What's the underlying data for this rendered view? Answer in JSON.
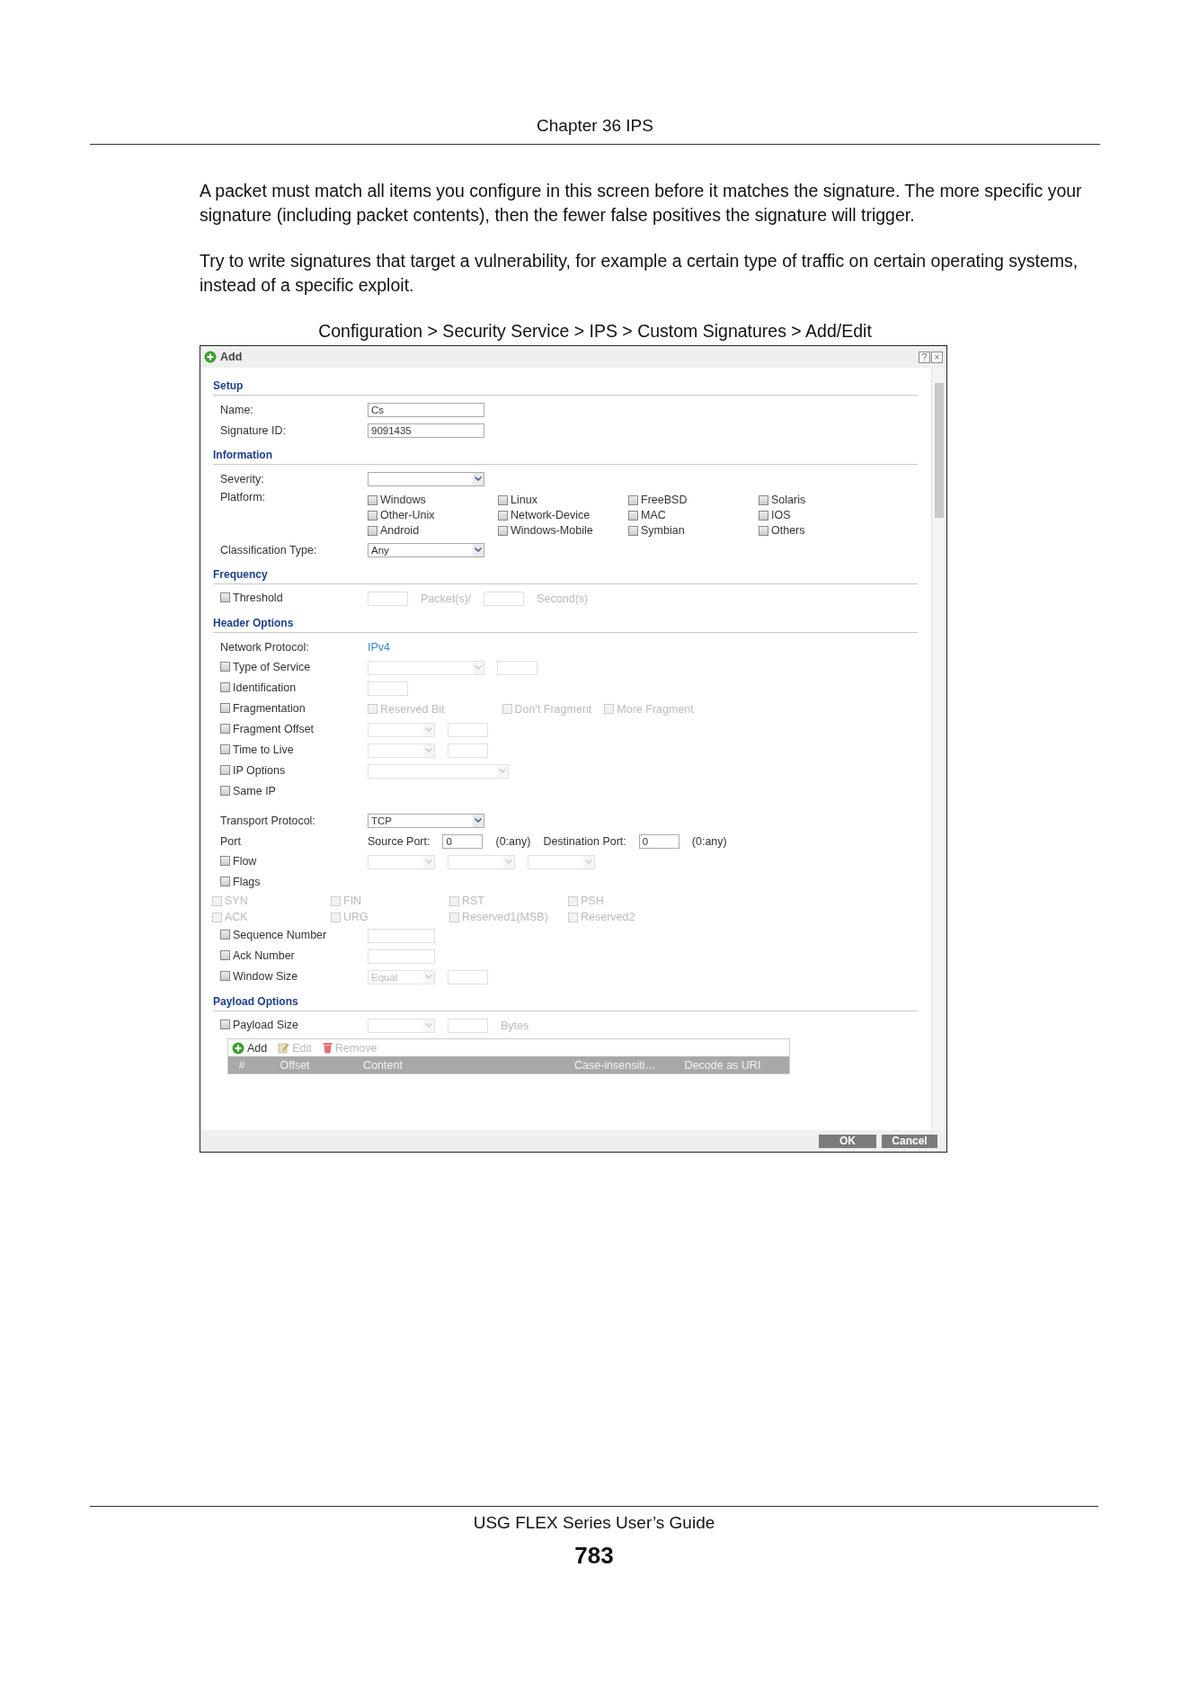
{
  "header": {
    "chapter": "Chapter 36 IPS"
  },
  "paragraphs": [
    "A packet must match all items you configure in this screen before it matches the signature. The more specific your signature (including packet contents), then the fewer false positives the signature will trigger.",
    "Try to write signatures that target a vulnerability, for example a certain type of traffic on certain operating systems, instead of a specific exploit."
  ],
  "caption": "Configuration > Security Service > IPS > Custom Signatures > Add/Edit",
  "dialog": {
    "title": "Add",
    "window_buttons": [
      "?",
      "×"
    ],
    "sections": [
      {
        "title": "Setup",
        "rows": [
          {
            "kind": "label",
            "label": "Name:",
            "controls": [
              {
                "kind": "field",
                "value": "Cs",
                "disabled": false
              }
            ]
          },
          {
            "kind": "label",
            "label": "Signature ID:",
            "controls": [
              {
                "kind": "field",
                "value": "9091435",
                "disabled": false
              }
            ]
          }
        ]
      },
      {
        "title": "Information",
        "rows": [
          {
            "kind": "label",
            "label": "Severity:",
            "controls": [
              {
                "kind": "select",
                "disabled": false
              }
            ]
          },
          {
            "kind": "grid",
            "label": "Platform:",
            "options": [
              {
                "label": "Windows",
                "checked": false,
                "disabled": false
              },
              {
                "label": "Linux",
                "checked": false,
                "disabled": false
              },
              {
                "label": "FreeBSD",
                "checked": false,
                "disabled": false
              },
              {
                "label": "Solaris",
                "checked": false,
                "disabled": false
              },
              {
                "label": "Other-Unix",
                "checked": false,
                "disabled": false
              },
              {
                "label": "Network-Device",
                "checked": false,
                "disabled": false
              },
              {
                "label": "MAC",
                "checked": false,
                "disabled": false
              },
              {
                "label": "IOS",
                "checked": false,
                "disabled": false
              },
              {
                "label": "Android",
                "checked": false,
                "disabled": false
              },
              {
                "label": "Windows-Mobile",
                "checked": false,
                "disabled": false
              },
              {
                "label": "Symbian",
                "checked": false,
                "disabled": false
              },
              {
                "label": "Others",
                "checked": false,
                "disabled": false
              }
            ]
          },
          {
            "kind": "label",
            "label": "Classification Type:",
            "controls": [
              {
                "kind": "select",
                "value": "Any",
                "disabled": false
              }
            ]
          }
        ]
      },
      {
        "title": "Frequency",
        "rows": [
          {
            "kind": "check",
            "label": "Threshold",
            "checked": false,
            "controls": [
              {
                "kind": "box",
                "disabled": true
              },
              {
                "kind": "text",
                "text": "Packet(s)/",
                "disabled": true
              },
              {
                "kind": "box",
                "disabled": true
              },
              {
                "kind": "text",
                "text": "Second(s)",
                "disabled": true
              }
            ]
          }
        ]
      },
      {
        "title": "Header Options",
        "rows": [
          {
            "kind": "label",
            "label": "Network Protocol:",
            "controls": [
              {
                "kind": "value",
                "text": "IPv4",
                "disabled": false
              }
            ]
          },
          {
            "kind": "check",
            "label": "Type of Service",
            "checked": false,
            "controls": [
              {
                "kind": "select",
                "disabled": true
              },
              {
                "kind": "box",
                "disabled": true
              }
            ]
          },
          {
            "kind": "check",
            "label": "Identification",
            "checked": false,
            "controls": [
              {
                "kind": "box",
                "disabled": true
              }
            ]
          },
          {
            "kind": "check",
            "label": "Fragmentation",
            "checked": false,
            "controls": [
              {
                "kind": "check",
                "text": "Reserved Bit",
                "checked": false,
                "disabled": true
              },
              {
                "kind": "check",
                "text": "Don't Fragment",
                "checked": false,
                "disabled": true
              },
              {
                "kind": "check",
                "text": "More Fragment",
                "checked": false,
                "disabled": true
              }
            ]
          },
          {
            "kind": "check",
            "label": "Fragment Offset",
            "checked": false,
            "controls": [
              {
                "kind": "small-select",
                "disabled": true
              },
              {
                "kind": "box",
                "disabled": true
              }
            ]
          },
          {
            "kind": "check",
            "label": "Time to Live",
            "checked": false,
            "controls": [
              {
                "kind": "small-select",
                "disabled": true
              },
              {
                "kind": "box",
                "disabled": true
              }
            ]
          },
          {
            "kind": "check",
            "label": "IP Options",
            "checked": false,
            "controls": [
              {
                "kind": "wide-select",
                "disabled": true
              }
            ]
          },
          {
            "kind": "check",
            "label": "Same IP",
            "checked": false,
            "controls": []
          }
        ]
      },
      {
        "rows": [
          {
            "kind": "label",
            "label": "Transport Protocol:",
            "controls": [
              {
                "kind": "select",
                "value": "TCP",
                "disabled": false
              }
            ]
          },
          {
            "kind": "label",
            "label": "Port",
            "controls": [
              {
                "kind": "text",
                "text": "Source Port:",
                "disabled": false
              },
              {
                "kind": "box",
                "value": "0",
                "disabled": false
              },
              {
                "kind": "text",
                "text": "(0:any)",
                "disabled": false
              },
              {
                "kind": "text",
                "text": "Destination Port:",
                "disabled": false
              },
              {
                "kind": "box",
                "value": "0",
                "disabled": false
              },
              {
                "kind": "text",
                "text": "(0:any)",
                "disabled": false
              }
            ]
          },
          {
            "kind": "check",
            "label": "Flow",
            "checked": false,
            "controls": [
              {
                "kind": "small-select",
                "disabled": true
              },
              {
                "kind": "small-select",
                "disabled": true
              },
              {
                "kind": "small-select",
                "disabled": true
              }
            ]
          },
          {
            "kind": "check",
            "label": "Flags",
            "checked": false,
            "controls": []
          },
          {
            "kind": "flags",
            "options": [
              {
                "label": "SYN",
                "checked": false,
                "disabled": true
              },
              {
                "label": "FIN",
                "checked": false,
                "disabled": true
              },
              {
                "label": "RST",
                "checked": false,
                "disabled": true
              },
              {
                "label": "PSH",
                "checked": false,
                "disabled": true
              },
              {
                "label": "ACK",
                "checked": false,
                "disabled": true
              },
              {
                "label": "URG",
                "checked": false,
                "disabled": true
              },
              {
                "label": "Reserved1(MSB)",
                "checked": false,
                "disabled": true
              },
              {
                "label": "Reserved2",
                "checked": false,
                "disabled": true
              }
            ]
          },
          {
            "kind": "check",
            "label": "Sequence Number",
            "checked": false,
            "controls": [
              {
                "kind": "mid-box",
                "disabled": true
              }
            ]
          },
          {
            "kind": "check",
            "label": "Ack Number",
            "checked": false,
            "controls": [
              {
                "kind": "mid-box",
                "disabled": true
              }
            ]
          },
          {
            "kind": "check",
            "label": "Window Size",
            "checked": false,
            "controls": [
              {
                "kind": "small-select",
                "value": "Equal",
                "disabled": true
              },
              {
                "kind": "box",
                "disabled": true
              }
            ]
          }
        ]
      },
      {
        "title": "Payload Options",
        "rows": [
          {
            "kind": "check",
            "label": "Payload Size",
            "checked": false,
            "controls": [
              {
                "kind": "small-select",
                "disabled": true
              },
              {
                "kind": "box",
                "disabled": true
              },
              {
                "kind": "text",
                "text": "Bytes",
                "disabled": true
              }
            ]
          },
          {
            "kind": "table",
            "toolbar": [
              {
                "kind": "add",
                "label": "Add",
                "disabled": false
              },
              {
                "kind": "edit",
                "label": "Edit",
                "disabled": true
              },
              {
                "kind": "remove",
                "label": "Remove",
                "disabled": true
              }
            ],
            "columns": [
              "#",
              "Offset",
              "Content",
              "Case-insensiti…",
              "Decode as URI"
            ]
          }
        ]
      }
    ],
    "buttons": [
      "OK",
      "Cancel"
    ]
  },
  "footer": {
    "guide": "USG FLEX Series User’s Guide",
    "page": "783"
  }
}
